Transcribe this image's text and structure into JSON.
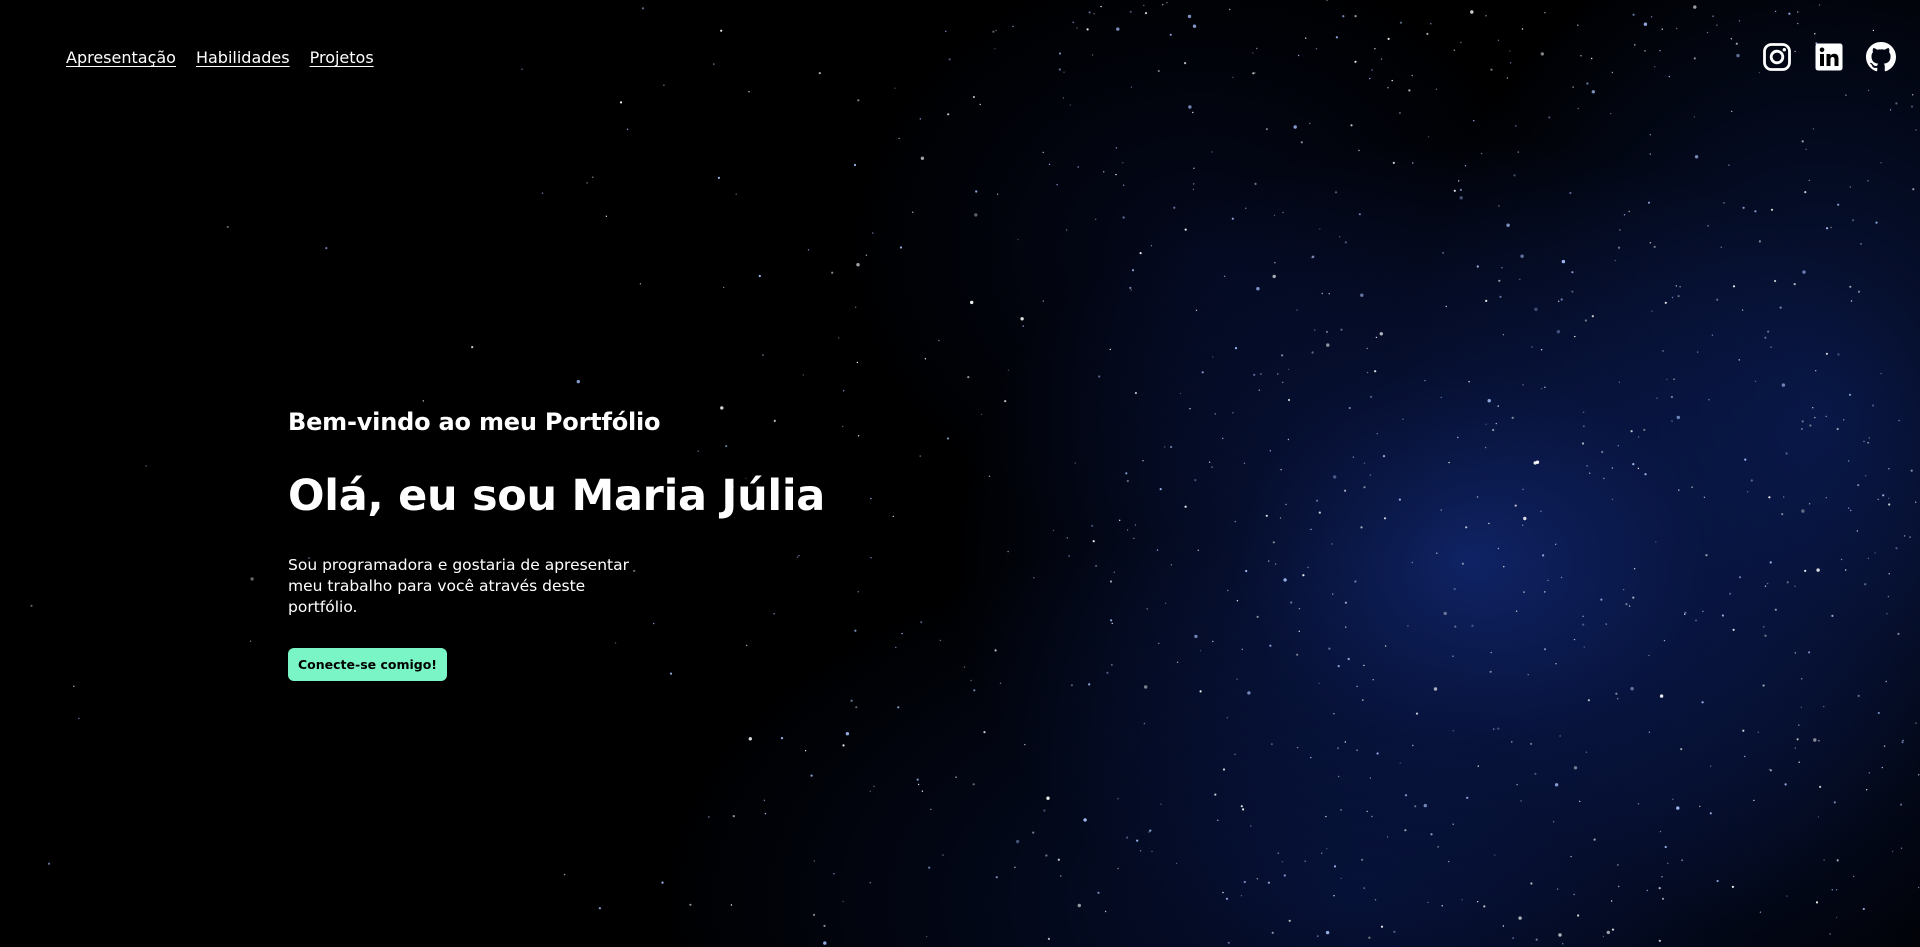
{
  "nav": {
    "links": [
      "Apresentação",
      "Habilidades",
      "Projetos"
    ]
  },
  "social": {
    "icons": [
      "instagram-icon",
      "linkedin-icon",
      "github-icon"
    ]
  },
  "hero": {
    "welcome": "Bem-vindo ao meu Portfólio",
    "title": "Olá, eu sou Maria Júlia",
    "description": "Sou programadora e gostaria de apresentar meu trabalho para você através deste portfólio.",
    "cta_label": "Conecte-se comigo!"
  },
  "colors": {
    "background": "#000000",
    "text": "#ffffff",
    "accent": "#7af5c5",
    "nebula": "#142d82"
  }
}
